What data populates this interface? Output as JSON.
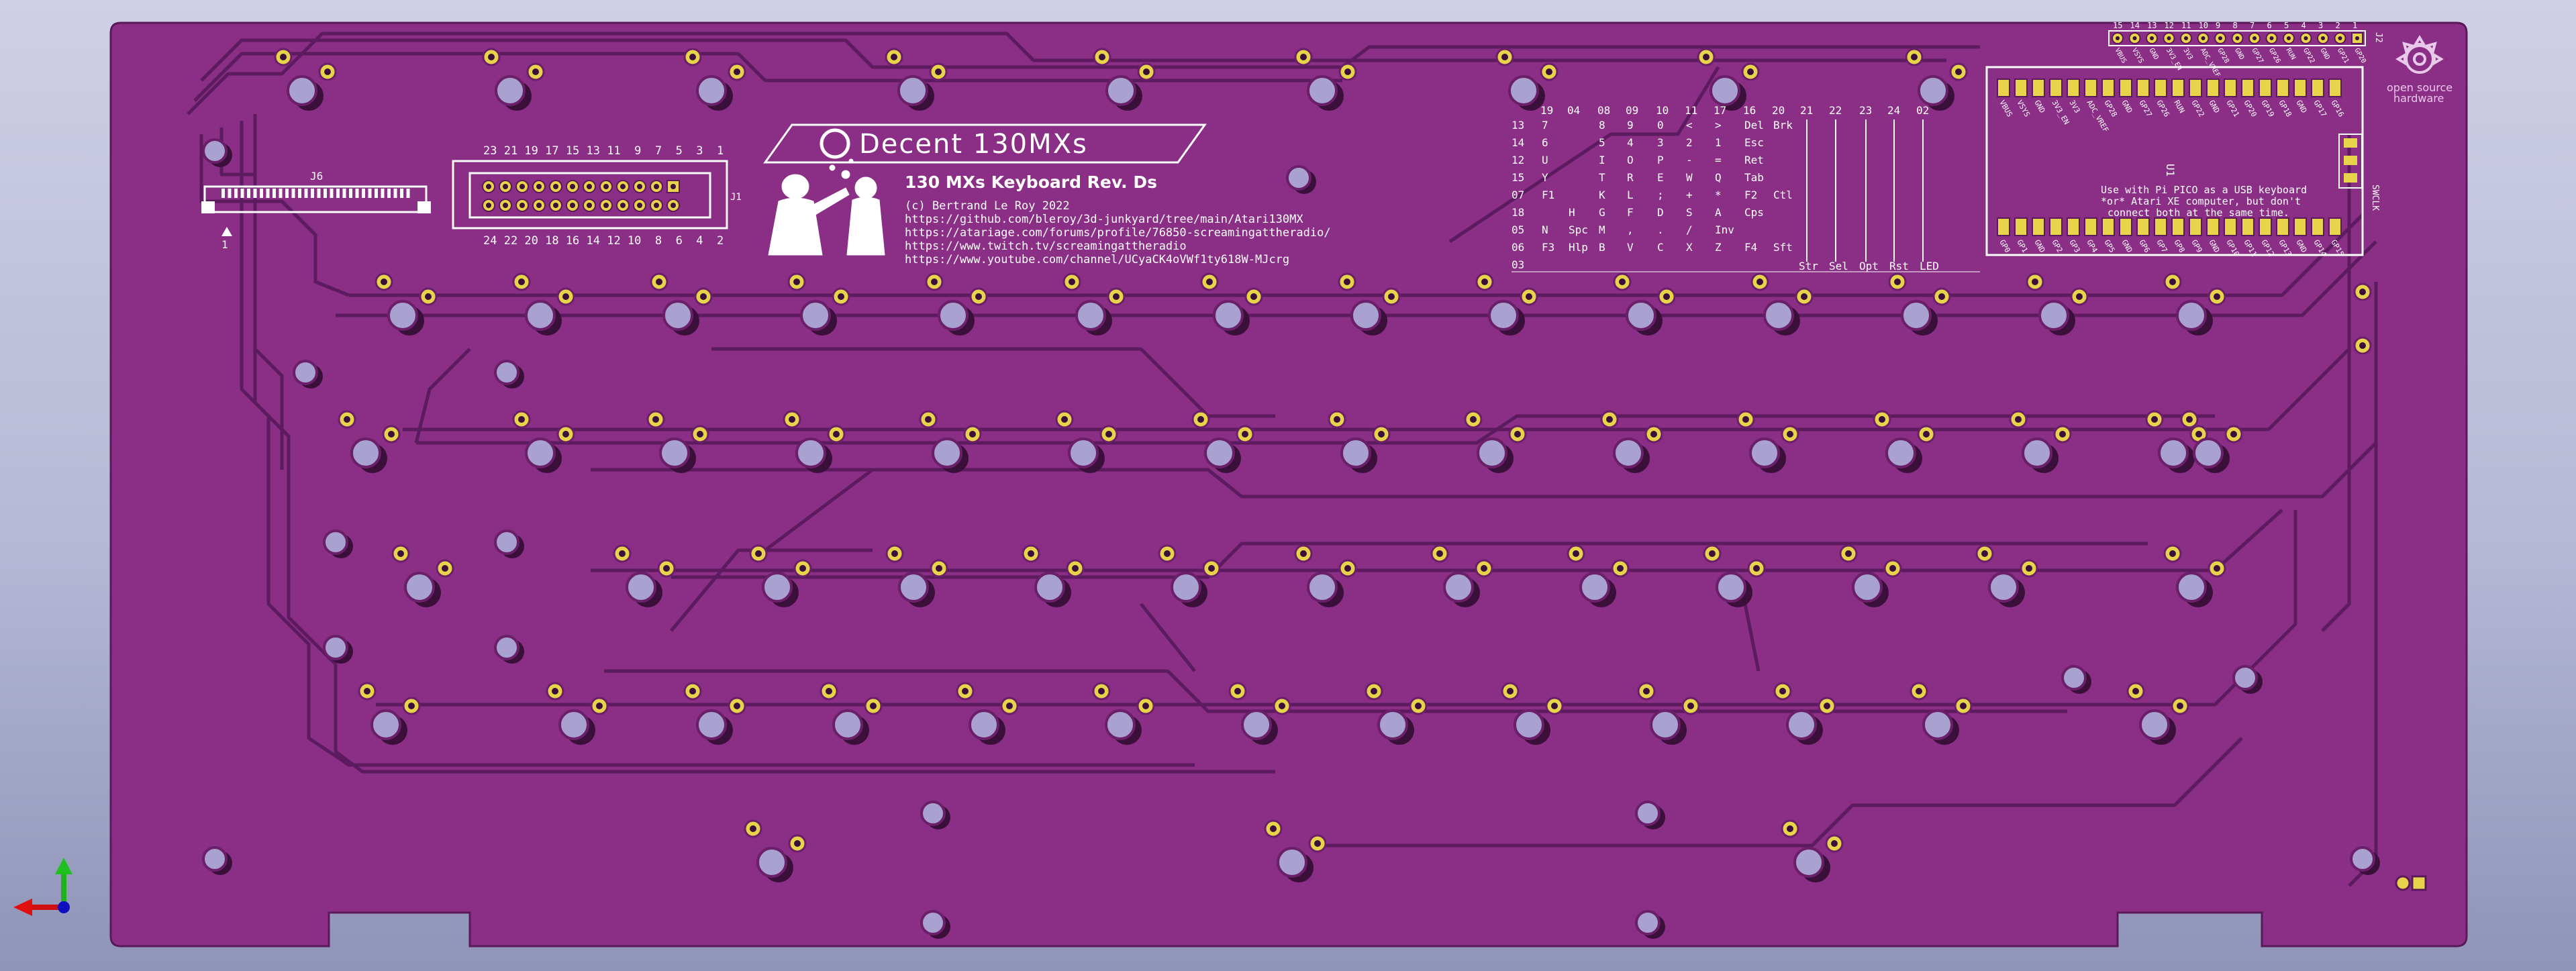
{
  "window": {
    "title": "3D Viewer"
  },
  "colors": {
    "board": "#8a2e86",
    "board_dark": "#6a1f68",
    "track": "#5c1a5f",
    "pad_gold": "#e8d44a",
    "silkscreen": "#ffffff",
    "background_top": "#cfcfe6",
    "background_bottom": "#8f94b8"
  },
  "silkscreen": {
    "logo_text": "Decent 130MXs",
    "board_title": "130 MXs Keyboard Rev. Ds",
    "copyright": "(c) Bertrand Le Roy 2022",
    "links": [
      "https://github.com/bleroy/3d-junkyard/tree/main/Atari130MX",
      "https://atariage.com/forums/profile/76850-screamingattheradio/",
      "https://www.twitch.tv/screamingattheradio",
      "https://www.youtube.com/channel/UCyaCK4oVWf1ty618W-MJcrg"
    ],
    "j6_label": "J6",
    "j6_pin1": "1",
    "j1_label": "J1",
    "j1_top_pins": "23 21 19 17 15 13 11  9  7  5  3  1",
    "j1_bottom_pins": "24 22 20 18 16 14 12 10  8  6  4  2",
    "pico_note": [
      "Use with Pi PICO as a USB keyboard",
      "*or* Atari XE computer, but don't",
      "connect both at the same time."
    ],
    "u1_label": "U1",
    "j2_label": "J2",
    "swd_label": "SWCLK",
    "oshw": [
      "open source",
      "hardware"
    ]
  },
  "key_matrix": {
    "column_headers": [
      "19",
      "04",
      "08",
      "09",
      "10",
      "11",
      "17",
      "16",
      "20",
      "21",
      "22",
      "23",
      "24",
      "02"
    ],
    "rows": [
      {
        "row": "13",
        "keys": [
          "7",
          "",
          "8",
          "9",
          "0",
          "<",
          ">",
          "Del",
          "Brk"
        ]
      },
      {
        "row": "14",
        "keys": [
          "6",
          "",
          "5",
          "4",
          "3",
          "2",
          "1",
          "Esc"
        ]
      },
      {
        "row": "12",
        "keys": [
          "U",
          "",
          "I",
          "O",
          "P",
          "-",
          "=",
          "Ret"
        ]
      },
      {
        "row": "15",
        "keys": [
          "Y",
          "",
          "T",
          "R",
          "E",
          "W",
          "Q",
          "Tab"
        ]
      },
      {
        "row": "07",
        "keys": [
          "F1",
          "",
          "K",
          "L",
          ";",
          "+",
          "*",
          "F2",
          "Ctl"
        ]
      },
      {
        "row": "18",
        "keys": [
          "",
          "H",
          "G",
          "F",
          "D",
          "S",
          "A",
          "Cps"
        ]
      },
      {
        "row": "05",
        "keys": [
          "N",
          "Spc",
          "M",
          ",",
          ".",
          "/",
          "Inv"
        ]
      },
      {
        "row": "06",
        "keys": [
          "F3",
          "Hlp",
          "B",
          "V",
          "C",
          "X",
          "Z",
          "F4",
          "Sft"
        ]
      },
      {
        "row": "03",
        "keys": []
      }
    ],
    "bottom_labels": [
      "Str",
      "Sel",
      "Opt",
      "Rst",
      "LED"
    ]
  },
  "pico_top_pins": [
    "15",
    "14",
    "13",
    "12",
    "11",
    "10",
    "9",
    "8",
    "7",
    "6",
    "5",
    "4",
    "3",
    "2",
    "1"
  ],
  "pico_pin_labels_top": [
    "VBUS",
    "VSYS",
    "GND",
    "3V3_EN",
    "3V3",
    "ADC_VREF",
    "GP28",
    "GND",
    "GP27",
    "GP26",
    "RUN",
    "GP22",
    "GND",
    "GP21",
    "GP20",
    "GP19",
    "GP18",
    "GND",
    "GP17",
    "GP16"
  ],
  "pico_pin_labels_bottom": [
    "GP0",
    "GP1",
    "GND",
    "GP2",
    "GP3",
    "GP4",
    "GP5",
    "GND",
    "GP6",
    "GP7",
    "GP8",
    "GP9",
    "GND",
    "GP10",
    "GP11",
    "GP12",
    "GP13",
    "GND",
    "GP14",
    "GP15"
  ]
}
